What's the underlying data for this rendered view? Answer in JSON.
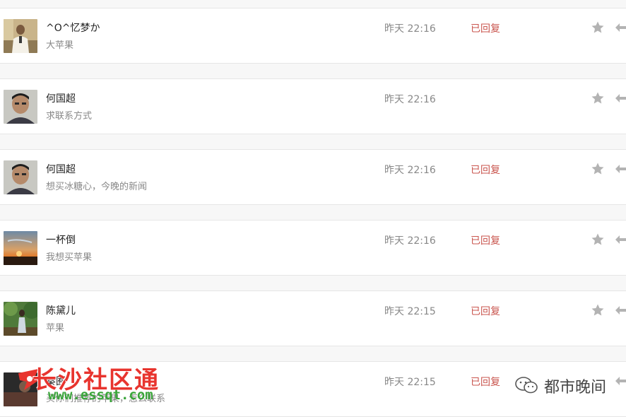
{
  "messages": [
    {
      "name": "^O^忆梦か",
      "preview": "大苹果",
      "time": "昨天 22:16",
      "status": "已回复",
      "avatar": "man-in-white-suit-photo"
    },
    {
      "name": "何国超",
      "preview": "求联系方式",
      "time": "昨天 22:16",
      "status": "",
      "avatar": "man-portrait-photo"
    },
    {
      "name": "何国超",
      "preview": "想买冰糖心，今晚的新闻",
      "time": "昨天 22:16",
      "status": "已回复",
      "avatar": "man-portrait-photo"
    },
    {
      "name": "一杯倒",
      "preview": "我想买苹果",
      "time": "昨天 22:16",
      "status": "已回复",
      "avatar": "sunset-photo"
    },
    {
      "name": "陈黛儿",
      "preview": "苹果",
      "time": "昨天 22:15",
      "status": "已回复",
      "avatar": "woman-in-garden-photo"
    },
    {
      "name": "秦囿",
      "preview": "买你们推荐的苹果，怎么联系",
      "time": "昨天 22:15",
      "status": "已回复",
      "avatar": "dark-photo"
    }
  ],
  "watermark_left": {
    "title": "长沙社区通",
    "url": "www.essqt.com"
  },
  "watermark_right": {
    "text": "都市晚间"
  },
  "colors": {
    "status": "#c9554e",
    "time": "#888888",
    "star": "#b3b3b3",
    "watermark_red": "#e8342e",
    "watermark_green": "#3aa53a"
  }
}
